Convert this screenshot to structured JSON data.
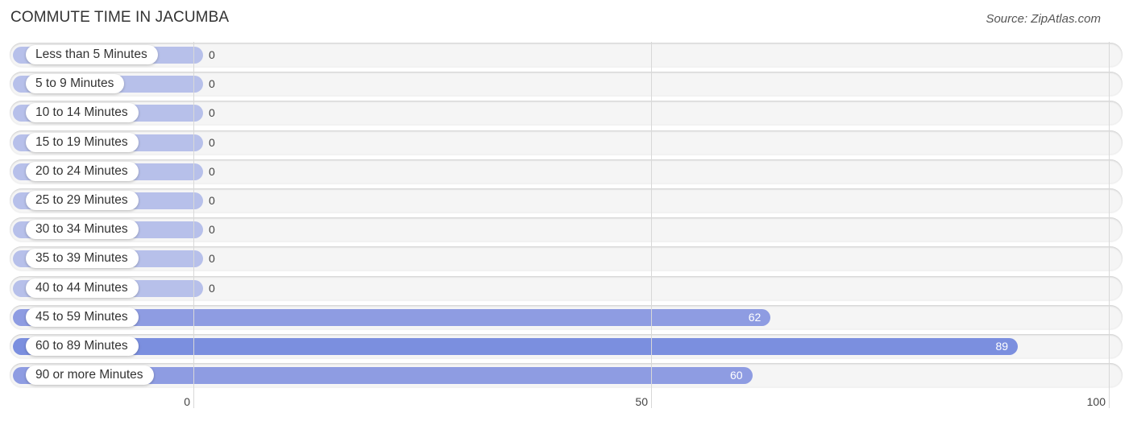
{
  "chart_data": {
    "type": "bar",
    "orientation": "horizontal",
    "title": "COMMUTE TIME IN JACUMBA",
    "source": "Source: ZipAtlas.com",
    "categories": [
      "Less than 5 Minutes",
      "5 to 9 Minutes",
      "10 to 14 Minutes",
      "15 to 19 Minutes",
      "20 to 24 Minutes",
      "25 to 29 Minutes",
      "30 to 34 Minutes",
      "35 to 39 Minutes",
      "40 to 44 Minutes",
      "45 to 59 Minutes",
      "60 to 89 Minutes",
      "90 or more Minutes"
    ],
    "values": [
      0,
      0,
      0,
      0,
      0,
      0,
      0,
      0,
      0,
      62,
      89,
      60
    ],
    "value_labels": [
      "0",
      "0",
      "0",
      "0",
      "0",
      "0",
      "0",
      "0",
      "0",
      "62",
      "89",
      "60"
    ],
    "xlim": [
      0,
      100
    ],
    "xticks": [
      0,
      50,
      100
    ],
    "xtick_labels": [
      "0",
      "50",
      "100"
    ],
    "grid": true,
    "colors": {
      "zero_bar": "#b7c0ea",
      "bar": "#8e9ce2",
      "max_bar": "#7b8fdf",
      "track": "#f5f5f5"
    }
  }
}
